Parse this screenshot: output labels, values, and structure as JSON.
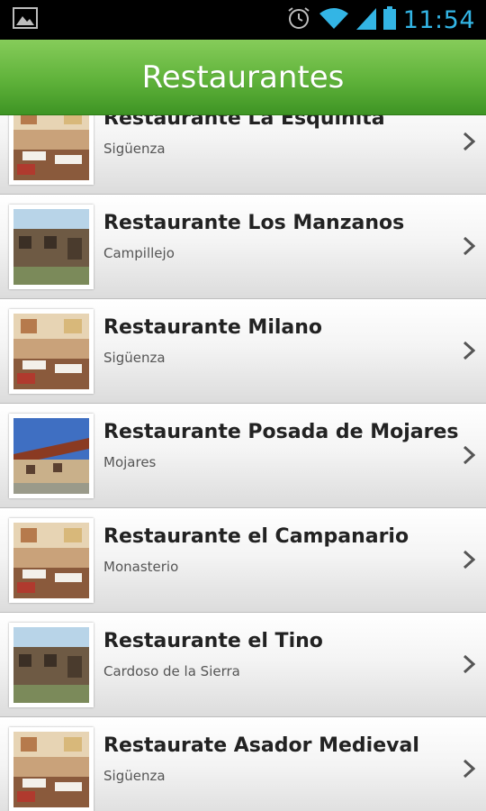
{
  "status_bar": {
    "time": "11:54",
    "icons": [
      "gallery-notification-icon",
      "alarm-icon",
      "wifi-icon",
      "signal-icon",
      "battery-icon"
    ],
    "accent_color": "#33b5e5"
  },
  "action_bar": {
    "title": "Restaurantes",
    "color": "#5fb23a"
  },
  "restaurants": [
    {
      "name": "Restaurante La Esquinita",
      "location": "Sigüenza",
      "thumb": "dining-room"
    },
    {
      "name": "Restaurante Los Manzanos",
      "location": "Campillejo",
      "thumb": "stone-building"
    },
    {
      "name": "Restaurante Milano",
      "location": "Sigüenza",
      "thumb": "dining-room"
    },
    {
      "name": "Restaurante Posada de Mojares",
      "location": "Mojares",
      "thumb": "village-building"
    },
    {
      "name": "Restaurante el Campanario",
      "location": "Monasterio",
      "thumb": "dining-room"
    },
    {
      "name": "Restaurante el Tino",
      "location": "Cardoso de la Sierra",
      "thumb": "stone-building"
    },
    {
      "name": "Restaurate Asador Medieval",
      "location": "Sigüenza",
      "thumb": "dining-room"
    }
  ]
}
